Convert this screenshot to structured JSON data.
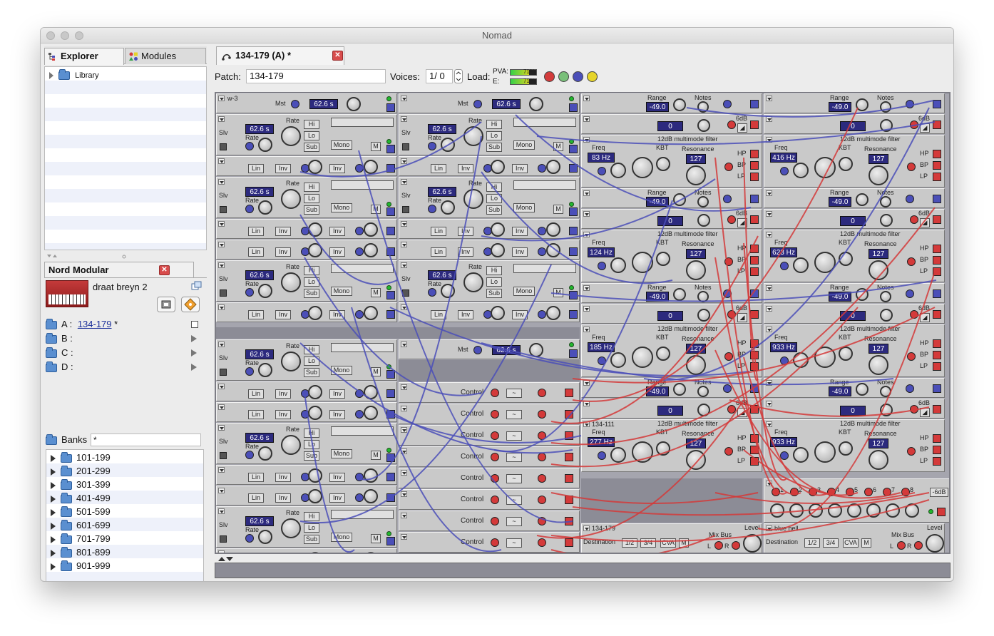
{
  "window": {
    "title": "Nomad"
  },
  "sidebar": {
    "tabs": [
      "Explorer",
      "Modules"
    ],
    "tree": [
      {
        "label": "Library"
      }
    ]
  },
  "nord": {
    "title": "Nord Modular",
    "synth_name": "draat breyn 2",
    "slots": [
      {
        "key": "A :",
        "patch": "134-179",
        "modified": "*"
      },
      {
        "key": "B :"
      },
      {
        "key": "C :"
      },
      {
        "key": "D :"
      }
    ],
    "banks_label": "Banks",
    "banks_filter": "*",
    "banks": [
      "101-199",
      "201-299",
      "301-399",
      "401-499",
      "501-599",
      "601-699",
      "701-799",
      "801-899",
      "901-999"
    ]
  },
  "patch_tab": {
    "label": "134-179 (A) *"
  },
  "toolbar": {
    "patch_label": "Patch:",
    "patch_value": "134-179",
    "voices_label": "Voices:",
    "voices_value": "1/ 0",
    "load_label": "Load:",
    "pva_label": "PVA:",
    "e_label": "E:",
    "pva_value": "71%",
    "e_value": "71%",
    "pva_fraction": 0.71,
    "e_fraction": 0.71,
    "ball_colors": [
      "#d33b3b",
      "#7ac07a",
      "#4b4fb8",
      "#e6d42a"
    ]
  },
  "rack": {
    "module_names": [
      "w-3",
      "134-111",
      "134-179",
      "blue hell"
    ],
    "lfo": {
      "mst": "Mst",
      "time": "62.6 s",
      "rate": "Rate",
      "slv": "Slv",
      "hi": "Hi",
      "lo": "Lo",
      "sub": "Sub",
      "mono": "Mono",
      "m": "M",
      "lin": "Lin",
      "inv": "Inv"
    },
    "filter": {
      "title": "12dB multimode filter",
      "freq": "Freq",
      "kbt": "KBT",
      "resonance": "Resonance",
      "res_value": "127",
      "hp": "HP",
      "bp": "BP",
      "lp": "LP",
      "freq_values": [
        "83 Hz",
        "416 Hz",
        "124 Hz",
        "623 Hz",
        "185 Hz",
        "933 Hz",
        "277 Hz",
        "933 Hz"
      ],
      "range": "Range",
      "range_value": "-49.0",
      "notes": "Notes",
      "zero": "0",
      "gdb": "6dB"
    },
    "control": {
      "label": "Control"
    },
    "mixer": {
      "channels": [
        "1",
        "2",
        "3",
        "4",
        "5",
        "6",
        "7",
        "8"
      ],
      "level": "-6dB"
    },
    "output": {
      "destination": "Destination",
      "dest_options": [
        "1/2",
        "3/4",
        "CVA",
        "M"
      ],
      "mix_bus": "Mix Bus",
      "level": "Level",
      "l": "L",
      "r": "R"
    }
  }
}
